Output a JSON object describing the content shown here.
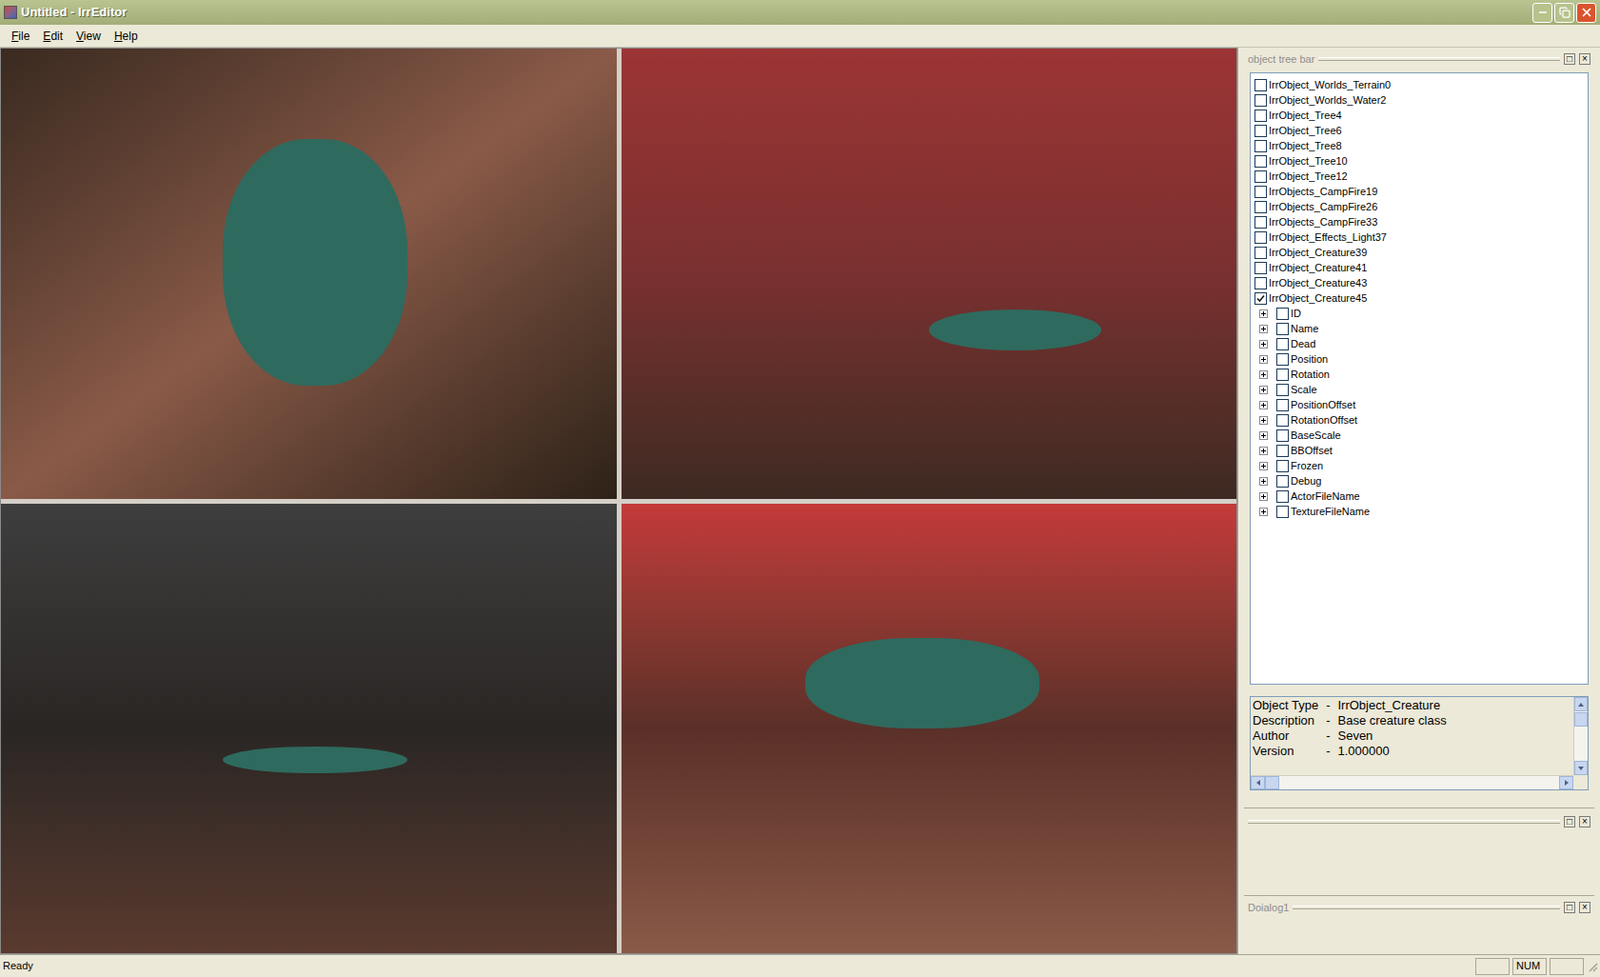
{
  "window": {
    "title": "Untitled - IrrEditor"
  },
  "menu": [
    "File",
    "Edit",
    "View",
    "Help"
  ],
  "object_tree": {
    "title": "object tree bar",
    "buttons": [
      "□",
      "×"
    ],
    "objects": [
      {
        "label": "IrrObject_Worlds_Terrain0",
        "checked": false,
        "expanded": false,
        "properties": []
      },
      {
        "label": "IrrObject_Worlds_Water2",
        "checked": false,
        "expanded": false,
        "properties": []
      },
      {
        "label": "IrrObject_Tree4",
        "checked": false,
        "expanded": false,
        "properties": []
      },
      {
        "label": "IrrObject_Tree6",
        "checked": false,
        "expanded": false,
        "properties": []
      },
      {
        "label": "IrrObject_Tree8",
        "checked": false,
        "expanded": false,
        "properties": []
      },
      {
        "label": "IrrObject_Tree10",
        "checked": false,
        "expanded": false,
        "properties": []
      },
      {
        "label": "IrrObject_Tree12",
        "checked": false,
        "expanded": false,
        "properties": []
      },
      {
        "label": "IrrObjects_CampFire19",
        "checked": false,
        "expanded": false,
        "properties": []
      },
      {
        "label": "IrrObjects_CampFire26",
        "checked": false,
        "expanded": false,
        "properties": []
      },
      {
        "label": "IrrObjects_CampFire33",
        "checked": false,
        "expanded": false,
        "properties": []
      },
      {
        "label": "IrrObject_Effects_Light37",
        "checked": false,
        "expanded": false,
        "properties": []
      },
      {
        "label": "IrrObject_Creature39",
        "checked": false,
        "expanded": false,
        "properties": []
      },
      {
        "label": "IrrObject_Creature41",
        "checked": false,
        "expanded": false,
        "properties": []
      },
      {
        "label": "IrrObject_Creature43",
        "checked": false,
        "expanded": false,
        "properties": []
      },
      {
        "label": "IrrObject_Creature45",
        "checked": true,
        "expanded": true,
        "properties": [
          {
            "label": "ID",
            "checked": false,
            "expanded": false
          },
          {
            "label": "Name",
            "checked": false,
            "expanded": false
          },
          {
            "label": "Dead",
            "checked": false,
            "expanded": false
          },
          {
            "label": "Position",
            "checked": false,
            "expanded": false
          },
          {
            "label": "Rotation",
            "checked": false,
            "expanded": false
          },
          {
            "label": "Scale",
            "checked": false,
            "expanded": false
          },
          {
            "label": "PositionOffset",
            "checked": false,
            "expanded": false
          },
          {
            "label": "RotationOffset",
            "checked": false,
            "expanded": false
          },
          {
            "label": "BaseScale",
            "checked": false,
            "expanded": false
          },
          {
            "label": "BBOffset",
            "checked": false,
            "expanded": false
          },
          {
            "label": "Frozen",
            "checked": false,
            "expanded": false
          },
          {
            "label": "Debug",
            "checked": false,
            "expanded": false
          },
          {
            "label": "ActorFileName",
            "checked": false,
            "expanded": false
          },
          {
            "label": "TextureFileName",
            "checked": false,
            "expanded": false
          }
        ]
      }
    ]
  },
  "info": {
    "rows": [
      {
        "label": "Object Type",
        "separator": "-",
        "value": "IrrObject_Creature"
      },
      {
        "label": "Description",
        "separator": "-",
        "value": "Base creature class"
      },
      {
        "label": "Author",
        "separator": "-",
        "value": "Seven"
      },
      {
        "label": "Version",
        "separator": "-",
        "value": "1.000000"
      }
    ]
  },
  "panel": {
    "buttons": [
      "□",
      "×"
    ]
  },
  "dialog": {
    "title": "Doialog1",
    "buttons": [
      "□",
      "×"
    ]
  },
  "status_bar": {
    "text": "Ready",
    "indicators": [
      "NUM"
    ]
  }
}
